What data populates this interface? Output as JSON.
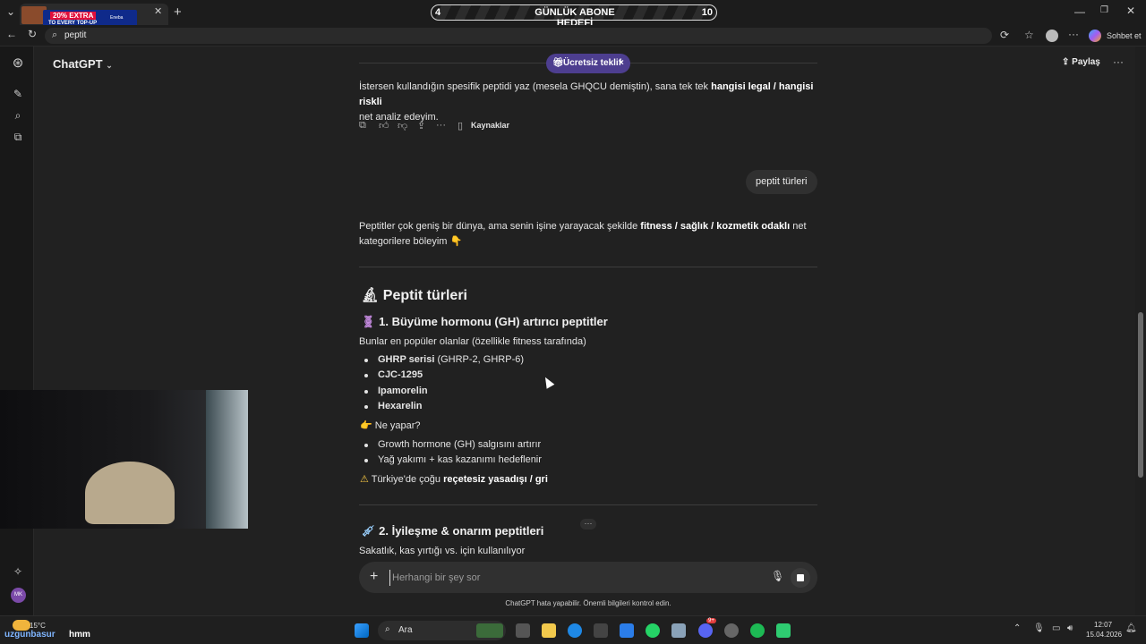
{
  "browser": {
    "ad": {
      "badge": "20% EXTRA",
      "tagline": "TO EVERY TOP-UP",
      "brand": "Eneba"
    },
    "goal": {
      "left_value": "4",
      "label": "GÜNLÜK ABONE HEDEFİ",
      "right_value": "10",
      "progress": 0.4
    },
    "address": "peptit",
    "profile_action": "Sohbet et"
  },
  "header": {
    "title": "ChatGPT",
    "offer": "Ücretsiz teklif",
    "share": "Paylaş"
  },
  "conversation": {
    "intro": {
      "part1": "İstersen kullandığın spesifik peptidi yaz (mesela GHQCU demiştin), sana tek tek ",
      "bold": "hangisi legal / hangisi riskli",
      "part2": "net analiz edeyim."
    },
    "actions": {
      "sources": "Kaynaklar"
    },
    "user_message": "peptit türleri",
    "reply_intro": {
      "part1": "Peptitler çok geniş bir dünya, ama senin işine yarayacak şekilde ",
      "bold": "fitness / sağlık / kozmetik odaklı",
      "part2": " net",
      "line2": "kategorilere böleyim 👇"
    },
    "heading": "Peptit türleri",
    "section1": {
      "title": "1. Büyüme hormonu (GH) artırıcı peptitler",
      "subtitle": "Bunlar en popüler olanlar (özellikle fitness tarafında)",
      "items": [
        {
          "bold": "GHRP serisi",
          "rest": " (GHRP-2, GHRP-6)"
        },
        {
          "bold": "CJC-1295",
          "rest": ""
        },
        {
          "bold": "Ipamorelin",
          "rest": ""
        },
        {
          "bold": "Hexarelin",
          "rest": ""
        }
      ],
      "what_label": "Ne yapar?",
      "effects": [
        "Growth hormone (GH) salgısını artırır",
        "Yağ yakımı + kas kazanımı hedeflenir"
      ],
      "warning_pre": "Türkiye'de çoğu ",
      "warning_bold": "reçetesiz yasadışı / gri"
    },
    "section2": {
      "title": "2. İyileşme & onarım peptitleri",
      "subtitle": "Sakatlık, kas yırtığı vs. için kullanılıyor"
    }
  },
  "composer": {
    "placeholder": "Herhangi bir şey sor"
  },
  "footnote": "ChatGPT hata yapabilir. Önemli bilgileri kontrol edin.",
  "overlay": {
    "streamer": "uzgunbasur",
    "chat": "hmm"
  },
  "weather": {
    "temp": "15°C"
  },
  "taskbar": {
    "search": "Ara",
    "time": "12:07",
    "date": "15.04.2026",
    "notification_count": "9+"
  },
  "rail": {
    "avatar": "MK"
  },
  "colors": {
    "background": "#212121",
    "offer_pill": "#4d3e8f",
    "composer": "#303030"
  }
}
